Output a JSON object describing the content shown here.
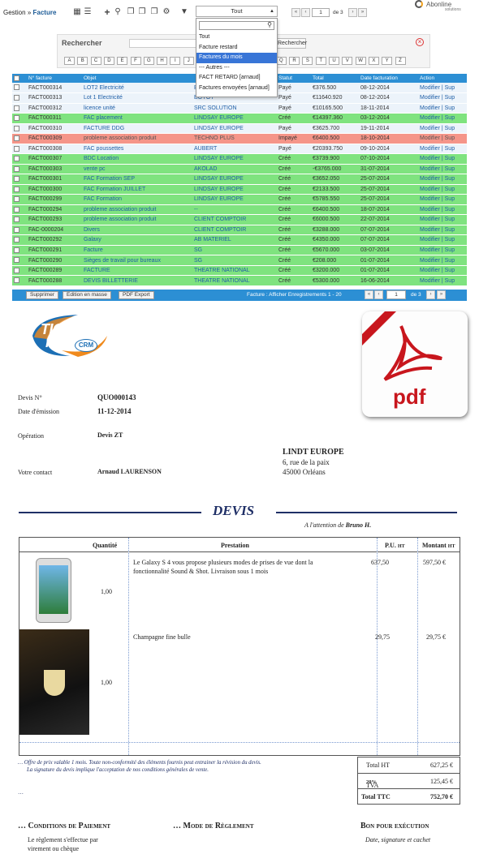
{
  "toolbar": {
    "breadcrumb_root": "Gestion",
    "breadcrumb_sep": "»",
    "breadcrumb_current": "Facture",
    "filter_value": "Tout",
    "page_input": "1",
    "page_total": "de 3"
  },
  "logo": {
    "name": "Abonline",
    "tagline": "solutions"
  },
  "filter_dropdown": {
    "search_value": "",
    "options": [
      "Tout",
      "Facture restard",
      "Factures du mois",
      "--- Autres ---",
      "FACT RETARD [arnaud]",
      "Factures envoyées [arnaud]"
    ],
    "selected": "Factures du mois"
  },
  "search": {
    "label": "Rechercher",
    "button": "Rechercher",
    "letters": [
      "A",
      "B",
      "C",
      "D",
      "E",
      "F",
      "G",
      "H",
      "I",
      "J",
      "K",
      "L",
      "M",
      "N",
      "O",
      "P",
      "Q",
      "R",
      "S",
      "T",
      "U",
      "V",
      "W",
      "X",
      "Y",
      "Z"
    ]
  },
  "table": {
    "columns": [
      "N° facture",
      "Objet",
      "",
      "Statut",
      "Total",
      "Date facturation",
      "Action"
    ],
    "action_edit": "Modifier",
    "action_sep": "|",
    "action_delete": "Sup",
    "rows": [
      {
        "num": "FACT000314",
        "objet": "LOT2 Electricité",
        "client": "BOYOT",
        "statut": "Payé",
        "total": "€376.500",
        "date": "08-12-2014",
        "color": "w"
      },
      {
        "num": "FACT000313",
        "objet": "Lot 1 Electricité",
        "client": "BOYOT",
        "statut": "Payé",
        "total": "€11640.920",
        "date": "08-12-2014",
        "color": "w"
      },
      {
        "num": "FACT000312",
        "objet": "licence unité",
        "client": "SRC SOLUTION",
        "statut": "Payé",
        "total": "€10165.500",
        "date": "18-11-2014",
        "color": "w"
      },
      {
        "num": "FACT000311",
        "objet": "FAC placement",
        "client": "LINDSAY EUROPE",
        "statut": "Créé",
        "total": "€14397.360",
        "date": "03-12-2014",
        "color": "g"
      },
      {
        "num": "FACT000310",
        "objet": "FACTURE DDG",
        "client": "LINDSAY EUROPE",
        "statut": "Payé",
        "total": "€3625.700",
        "date": "19-11-2014",
        "color": "w"
      },
      {
        "num": "FACT000309",
        "objet": "probleme association produit",
        "client": "TECHNO PLUS",
        "statut": "Impayé",
        "total": "€6400.500",
        "date": "18-10-2014",
        "color": "r"
      },
      {
        "num": "FACT000308",
        "objet": "FAC poussettes",
        "client": "AUBERT",
        "statut": "Payé",
        "total": "€20393.750",
        "date": "09-10-2014",
        "color": "w"
      },
      {
        "num": "FACT000307",
        "objet": "BDC Location",
        "client": "LINDSAY EUROPE",
        "statut": "Créé",
        "total": "€3739.900",
        "date": "07-10-2014",
        "color": "g"
      },
      {
        "num": "FACT000303",
        "objet": "vente pc",
        "client": "AKOLAD",
        "statut": "Créé",
        "total": "-€3765.000",
        "date": "31-07-2014",
        "color": "g"
      },
      {
        "num": "FACT000301",
        "objet": "FAC Formation SEP",
        "client": "LINDSAY EUROPE",
        "statut": "Créé",
        "total": "€3652.050",
        "date": "25-07-2014",
        "color": "g"
      },
      {
        "num": "FACT000300",
        "objet": "FAC Formation JUILLET",
        "client": "LINDSAY EUROPE",
        "statut": "Créé",
        "total": "€2133.500",
        "date": "25-07-2014",
        "color": "g"
      },
      {
        "num": "FACT000299",
        "objet": "FAC Formation",
        "client": "LINDSAY EUROPE",
        "statut": "Créé",
        "total": "€5785.550",
        "date": "25-07-2014",
        "color": "g"
      },
      {
        "num": "FACT000294",
        "objet": "probleme association produit",
        "client": "--",
        "statut": "Créé",
        "total": "€6400.500",
        "date": "18-07-2014",
        "color": "g"
      },
      {
        "num": "FACT000293",
        "objet": "probleme association produit",
        "client": "CLIENT COMPTOIR",
        "statut": "Créé",
        "total": "€6000.500",
        "date": "22-07-2014",
        "color": "g"
      },
      {
        "num": "FAC-0000204",
        "objet": "Divers",
        "client": "CLIENT COMPTOIR",
        "statut": "Créé",
        "total": "€3288.000",
        "date": "07-07-2014",
        "color": "g"
      },
      {
        "num": "FACT000292",
        "objet": "Galaxy",
        "client": "AB MATERIEL",
        "statut": "Créé",
        "total": "€4350.000",
        "date": "07-07-2014",
        "color": "g"
      },
      {
        "num": "FACT000291",
        "objet": "Facture",
        "client": "SG",
        "statut": "Créé",
        "total": "€5670.000",
        "date": "03-07-2014",
        "color": "g"
      },
      {
        "num": "FACT000290",
        "objet": "Sièges de travail pour bureaux",
        "client": "SG",
        "statut": "Créé",
        "total": "€208.000",
        "date": "01-07-2014",
        "color": "g"
      },
      {
        "num": "FACT000289",
        "objet": "FACTURE",
        "client": "THEATRE NATIONAL",
        "statut": "Créé",
        "total": "€3200.000",
        "date": "01-07-2014",
        "color": "g"
      },
      {
        "num": "FACT000288",
        "objet": "DEVIS BILLETTERIE",
        "client": "THEATRE NATIONAL",
        "statut": "Créé",
        "total": "€5300.000",
        "date": "16-06-2014",
        "color": "g"
      }
    ]
  },
  "table_footer": {
    "delete_btn": "Supprimer",
    "bulk_edit_btn": "Edition en masse",
    "pdf_btn": "PDF Export",
    "info": "Facture : Afficher Enregistrements 1 - 20",
    "page_input": "1",
    "page_total": "de 3"
  },
  "devis": {
    "logo_tiger": "TIGER",
    "logo_pro": "PRO",
    "logo_crm": "CRM",
    "pdf_text": "pdf",
    "devis_no_label": "Devis N°",
    "devis_no": "QUO000143",
    "date_label": "Date d'émission",
    "date": "11-12-2014",
    "operation_label": "Opération",
    "operation": "Devis ZT",
    "contact_label": "Votre contact",
    "contact": "Arnaud LAURENSON",
    "client_name": "LINDT EUROPE",
    "client_addr1": "6, rue de la paix",
    "client_addr2": "45000 Orléans",
    "title": "DEVIS",
    "attention_prefix": "A l'attention de",
    "attention_name": "Bruno H.",
    "col_qty": "Quantité",
    "col_prest": "Prestation",
    "col_pu": "P.U.",
    "col_pu_suffix": "HT",
    "col_mt": "Montant",
    "col_mt_suffix": "HT",
    "items": [
      {
        "qty": "1,00",
        "desc": "Le Galaxy S 4 vous propose plusieurs modes de prises de vue dont la fonctionnalité Sound & Shot. Livraison sous 1 mois",
        "pu": "637,50",
        "mt": "597,50 €"
      },
      {
        "qty": "1,00",
        "desc": "Champagne fine bulle",
        "pu": "29,75",
        "mt": "29,75 €"
      }
    ],
    "note1": "… Offre de prix valable 1 mois. Toute non-conformité des éléments fournis peut entrainer la révision du devis.",
    "note2": "La signature du devis implique l'acceptation de nos conditions générales de vente.",
    "note3": "…",
    "total_ht_label": "Total HT",
    "total_ht": "627,25 €",
    "tva_label": "TVA",
    "tva_rate": "20%",
    "tva": "125,45 €",
    "total_ttc_label": "Total TTC",
    "total_ttc": "752,70 €",
    "cond_title": "… Conditions de Paiement",
    "cond_text1": "Le règlement s'effectue par",
    "cond_text2": "virement ou chèque",
    "mode_title": "… Mode de Règlement",
    "bon_title": "Bon pour exécution",
    "bon_sub": "Date, signature et cachet"
  },
  "colors": {
    "header_blue": "#2c8fd4",
    "row_green": "#7fe37f",
    "row_red": "#f59589",
    "row_light": "#ecf3fa",
    "devis_navy": "#1f2f66"
  }
}
